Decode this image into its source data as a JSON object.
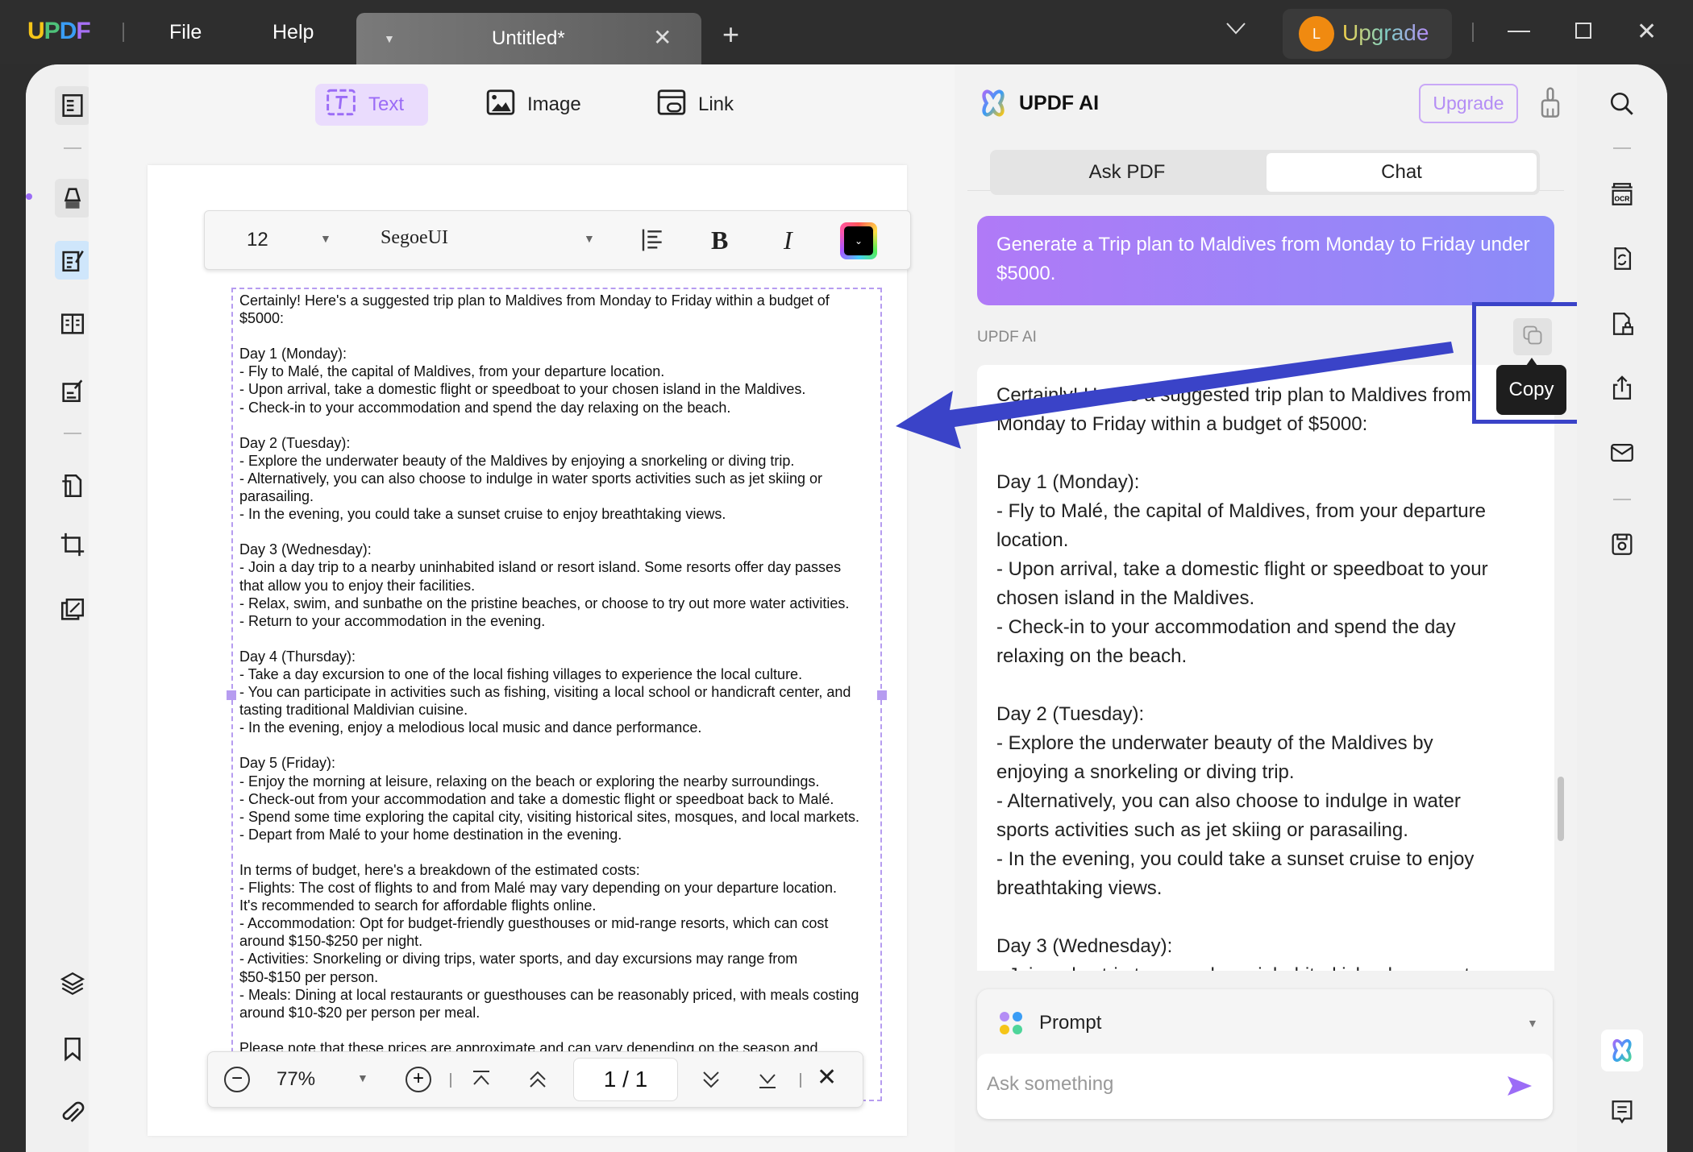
{
  "titlebar": {
    "logo": "UPDF",
    "menu": [
      "File",
      "Help"
    ],
    "tab_title": "Untitled*",
    "upgrade": "Upgrade",
    "avatar_initial": "L"
  },
  "toolbar": {
    "text": "Text",
    "image": "Image",
    "link": "Link"
  },
  "format": {
    "font_size": "12",
    "font_name": "SegoeUI",
    "bold": "B",
    "italic": "I",
    "color": "#000000"
  },
  "document": {
    "lines": [
      "Certainly! Here's a suggested trip plan to Maldives from Monday to Friday within a budget of",
      "$5000:",
      "",
      "Day 1 (Monday):",
      "- Fly to Malé, the capital of Maldives, from your departure location.",
      "- Upon arrival, take a domestic flight or speedboat to your chosen island in the Maldives.",
      "- Check-in to your accommodation and spend the day relaxing on the beach.",
      "",
      "Day 2 (Tuesday):",
      "- Explore the underwater beauty of the Maldives by enjoying a snorkeling or diving trip.",
      "- Alternatively, you can also choose to indulge in water sports activities such as jet skiing or",
      "parasailing.",
      "- In the evening, you could take a sunset cruise to enjoy breathtaking views.",
      "",
      "Day 3 (Wednesday):",
      "- Join a day trip to a nearby uninhabited island or resort island. Some resorts offer day passes",
      "that allow you to enjoy their facilities.",
      "- Relax, swim, and sunbathe on the pristine beaches, or choose to try out more water activities.",
      "- Return to your accommodation in the evening.",
      "",
      "Day 4 (Thursday):",
      "- Take a day excursion to one of the local fishing villages to experience the local culture.",
      "- You can participate in activities such as fishing, visiting a local school or handicraft center, and",
      "tasting traditional Maldivian cuisine.",
      "- In the evening, enjoy a melodious local music and dance performance.",
      "",
      "Day 5 (Friday):",
      "- Enjoy the morning at leisure, relaxing on the beach or exploring the nearby surroundings.",
      "- Check-out from your accommodation and take a domestic flight or speedboat back to Malé.",
      "- Spend some time exploring the capital city, visiting historical sites, mosques, and local markets.",
      "- Depart from Malé to your home destination in the evening.",
      "",
      "In terms of budget, here's a breakdown of the estimated costs:",
      "- Flights: The cost of flights to and from Malé may vary depending on your departure location.",
      "It's recommended to search for affordable flights online.",
      "- Accommodation: Opt for budget-friendly guesthouses or mid-range resorts, which can cost",
      "around $150-$250 per night.",
      "- Activities: Snorkeling or diving trips, water sports, and day excursions may range from",
      "$50-$150 per person.",
      "- Meals: Dining at local restaurants or guesthouses can be reasonably priced, with meals costing",
      "around $10-$20 per person per meal.",
      "",
      "Please note that these prices are approximate and can vary depending on the season and"
    ]
  },
  "pagenav": {
    "zoom": "77%",
    "page": "1 / 1"
  },
  "ai": {
    "title": "UPDF AI",
    "upgrade": "Upgrade",
    "tabs": [
      "Ask PDF",
      "Chat"
    ],
    "user_message": "Generate a Trip plan to Maldives from Monday to Friday under $5000.",
    "sender": "UPDF AI",
    "copy_tooltip": "Copy",
    "response_lines": [
      "Certainly! Here's a suggested trip plan to Maldives from",
      "Monday to Friday within a budget of $5000:",
      "",
      "Day 1 (Monday):",
      "- Fly to Malé, the capital of Maldives, from your departure",
      "location.",
      "- Upon arrival, take a domestic flight or speedboat to your",
      "chosen island in the Maldives.",
      "- Check-in to your accommodation and spend the day",
      "relaxing on the beach.",
      "",
      "Day 2 (Tuesday):",
      "- Explore the underwater beauty of the Maldives by",
      "enjoying a snorkeling or diving trip.",
      "- Alternatively, you can also choose to indulge in water",
      "sports activities such as jet skiing or parasailing.",
      "- In the evening, you could take a sunset cruise to enjoy",
      "breathtaking views.",
      "",
      "Day 3 (Wednesday):",
      "- Join a day trip to a nearby uninhabited island or resort"
    ],
    "prompt_label": "Prompt",
    "input_placeholder": "Ask something"
  },
  "colors": {
    "accent": "#9b6cf6",
    "annotation": "#3a43c8",
    "titlebar": "#2e2e2e"
  }
}
